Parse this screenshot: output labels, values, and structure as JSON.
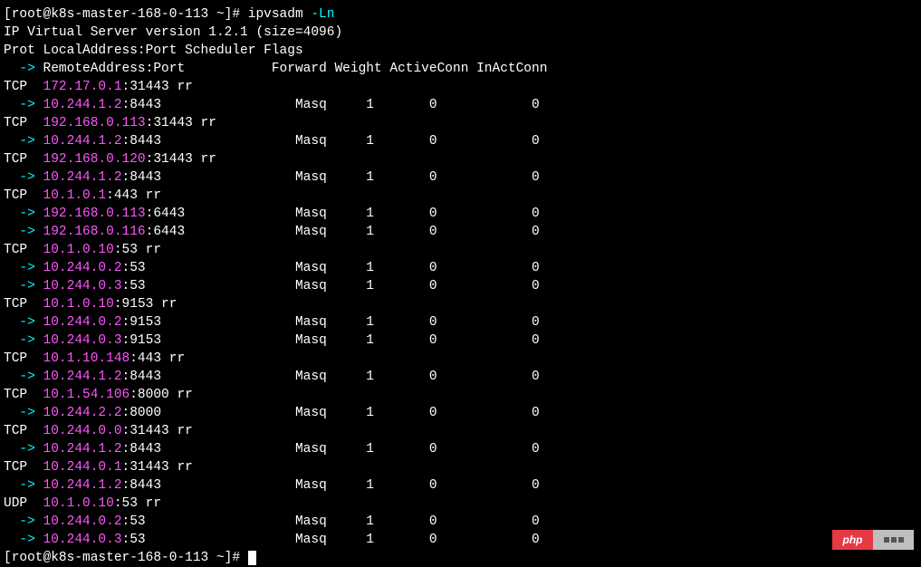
{
  "prompt": {
    "user_host": "[root@k8s-master-168-0-113 ~]#",
    "command": "ipvsadm",
    "flag": "-Ln"
  },
  "version_line": "IP Virtual Server version 1.2.1 (size=4096)",
  "header1": "Prot LocalAddress:Port Scheduler Flags",
  "header2_arrow": "  ->",
  "header2_remote": " RemoteAddress:Port",
  "header2_cols": "           Forward Weight ActiveConn InActConn",
  "rules": [
    {
      "proto": "TCP",
      "ip": "172.17.0.1",
      "port": ":31443 rr",
      "dests": [
        {
          "ip": "10.244.1.2",
          "port": ":8443",
          "fwd": "Masq",
          "w": "1",
          "a": "0",
          "i": "0"
        }
      ]
    },
    {
      "proto": "TCP",
      "ip": "192.168.0.113",
      "port": ":31443 rr",
      "dests": [
        {
          "ip": "10.244.1.2",
          "port": ":8443",
          "fwd": "Masq",
          "w": "1",
          "a": "0",
          "i": "0"
        }
      ]
    },
    {
      "proto": "TCP",
      "ip": "192.168.0.120",
      "port": ":31443 rr",
      "dests": [
        {
          "ip": "10.244.1.2",
          "port": ":8443",
          "fwd": "Masq",
          "w": "1",
          "a": "0",
          "i": "0"
        }
      ]
    },
    {
      "proto": "TCP",
      "ip": "10.1.0.1",
      "port": ":443 rr",
      "dests": [
        {
          "ip": "192.168.0.113",
          "port": ":6443",
          "fwd": "Masq",
          "w": "1",
          "a": "0",
          "i": "0"
        },
        {
          "ip": "192.168.0.116",
          "port": ":6443",
          "fwd": "Masq",
          "w": "1",
          "a": "0",
          "i": "0"
        }
      ]
    },
    {
      "proto": "TCP",
      "ip": "10.1.0.10",
      "port": ":53 rr",
      "dests": [
        {
          "ip": "10.244.0.2",
          "port": ":53",
          "fwd": "Masq",
          "w": "1",
          "a": "0",
          "i": "0"
        },
        {
          "ip": "10.244.0.3",
          "port": ":53",
          "fwd": "Masq",
          "w": "1",
          "a": "0",
          "i": "0"
        }
      ]
    },
    {
      "proto": "TCP",
      "ip": "10.1.0.10",
      "port": ":9153 rr",
      "dests": [
        {
          "ip": "10.244.0.2",
          "port": ":9153",
          "fwd": "Masq",
          "w": "1",
          "a": "0",
          "i": "0"
        },
        {
          "ip": "10.244.0.3",
          "port": ":9153",
          "fwd": "Masq",
          "w": "1",
          "a": "0",
          "i": "0"
        }
      ]
    },
    {
      "proto": "TCP",
      "ip": "10.1.10.148",
      "port": ":443 rr",
      "dests": [
        {
          "ip": "10.244.1.2",
          "port": ":8443",
          "fwd": "Masq",
          "w": "1",
          "a": "0",
          "i": "0"
        }
      ]
    },
    {
      "proto": "TCP",
      "ip": "10.1.54.106",
      "port": ":8000 rr",
      "dests": [
        {
          "ip": "10.244.2.2",
          "port": ":8000",
          "fwd": "Masq",
          "w": "1",
          "a": "0",
          "i": "0"
        }
      ]
    },
    {
      "proto": "TCP",
      "ip": "10.244.0.0",
      "port": ":31443 rr",
      "dests": [
        {
          "ip": "10.244.1.2",
          "port": ":8443",
          "fwd": "Masq",
          "w": "1",
          "a": "0",
          "i": "0"
        }
      ]
    },
    {
      "proto": "TCP",
      "ip": "10.244.0.1",
      "port": ":31443 rr",
      "dests": [
        {
          "ip": "10.244.1.2",
          "port": ":8443",
          "fwd": "Masq",
          "w": "1",
          "a": "0",
          "i": "0"
        }
      ]
    },
    {
      "proto": "UDP",
      "ip": "10.1.0.10",
      "port": ":53 rr",
      "dests": [
        {
          "ip": "10.244.0.2",
          "port": ":53",
          "fwd": "Masq",
          "w": "1",
          "a": "0",
          "i": "0"
        },
        {
          "ip": "10.244.0.3",
          "port": ":53",
          "fwd": "Masq",
          "w": "1",
          "a": "0",
          "i": "0"
        }
      ]
    }
  ],
  "end_prompt": "[root@k8s-master-168-0-113 ~]#",
  "badge_text": "php",
  "cols": {
    "fwd_at": 37,
    "w_at": 46,
    "a_at": 54,
    "i_at": 67
  }
}
